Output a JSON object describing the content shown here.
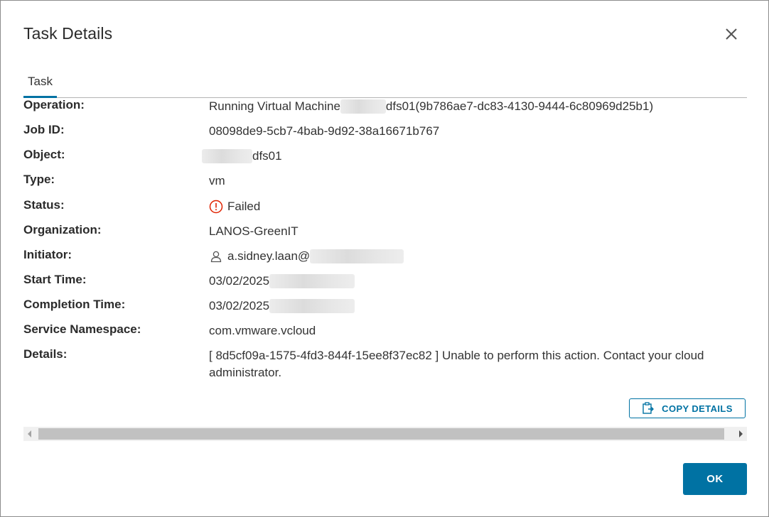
{
  "dialog": {
    "title": "Task Details",
    "close_icon": "close-icon"
  },
  "tabs": [
    {
      "label": "Task",
      "active": true
    }
  ],
  "fields": {
    "operation": {
      "label": "Operation:",
      "prefix": "Running Virtual Machine",
      "suffix": "dfs01(9b786ae7-dc83-4130-9444-6c80969d25b1)"
    },
    "job_id": {
      "label": "Job ID:",
      "value": "08098de9-5cb7-4bab-9d92-38a16671b767"
    },
    "object": {
      "label": "Object:",
      "suffix": "dfs01"
    },
    "type": {
      "label": "Type:",
      "value": "vm"
    },
    "status": {
      "label": "Status:",
      "value": "Failed",
      "icon": "error-circle-icon",
      "color": "#e02200"
    },
    "organization": {
      "label": "Organization:",
      "value": "LANOS-GreenIT"
    },
    "initiator": {
      "label": "Initiator:",
      "prefix": "a.sidney.laan@",
      "icon": "user-icon"
    },
    "start_time": {
      "label": "Start Time:",
      "prefix": "03/02/2025"
    },
    "completion_time": {
      "label": "Completion Time:",
      "prefix": "03/02/2025"
    },
    "service_namespace": {
      "label": "Service Namespace:",
      "value": "com.vmware.vcloud"
    },
    "details": {
      "label": "Details:",
      "value": "[ 8d5cf09a-1575-4fd3-844f-15ee8f37ec82 ] Unable to perform this action. Contact your cloud administrator."
    }
  },
  "actions": {
    "copy_details_label": "COPY DETAILS",
    "copy_icon": "clipboard-copy-icon",
    "ok_label": "OK"
  },
  "colors": {
    "accent": "#0072a3",
    "error": "#e02200"
  }
}
